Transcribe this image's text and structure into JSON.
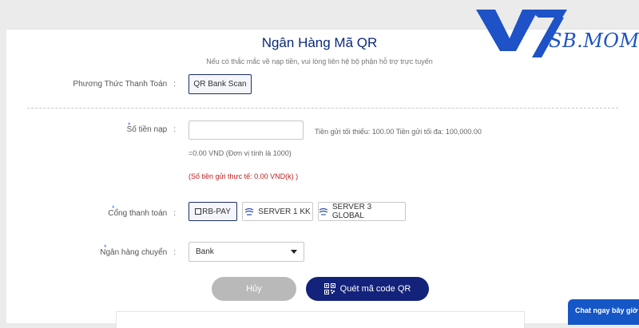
{
  "brand": {
    "logo_text": "SB.MOM",
    "colors": {
      "primary": "#13227a",
      "logo_blue": "#1e52c6",
      "warning": "#c21b1b"
    }
  },
  "page": {
    "title": "Ngân Hàng Mã QR",
    "subtitle": "Nếu có thắc mắc về nạp tiền, vui lòng liên hệ bộ phận hỗ trợ trực tuyến"
  },
  "payment_method": {
    "label": "Phương Thức Thanh Toán",
    "colon": ":",
    "option": "QR Bank Scan"
  },
  "amount": {
    "required_mark": "*",
    "label": "Số tiền nạp",
    "colon": ":",
    "value": "",
    "limits": "Tiền gửi tối thiểu: 100.00 Tiền gửi tối đa: 100,000.00",
    "conversion": "=0.00 VND (Đơn vị tính là 1000)",
    "actual": "(Số tiền gửi thực tế: 0.00 VND(k) )"
  },
  "gateway": {
    "required_mark": "*",
    "label": "Cổng thanh toán",
    "colon": ":",
    "options": [
      {
        "label": "RB-PAY",
        "icon": "square-icon",
        "selected": true
      },
      {
        "label": "SERVER 1 KK",
        "icon": "server-icon",
        "selected": false
      },
      {
        "label": "SERVER 3 GLOBAL",
        "icon": "server-icon",
        "selected": false
      }
    ]
  },
  "bank": {
    "required_mark": "*",
    "label": "Ngân hàng chuyển",
    "colon": ":",
    "selected": "Bank",
    "icon": "chevron-down-icon"
  },
  "actions": {
    "cancel": "Hủy",
    "scan": "Quét mã code QR",
    "scan_icon": "qr-code-icon"
  },
  "chat": {
    "label": "Chat ngay bây giờ"
  }
}
